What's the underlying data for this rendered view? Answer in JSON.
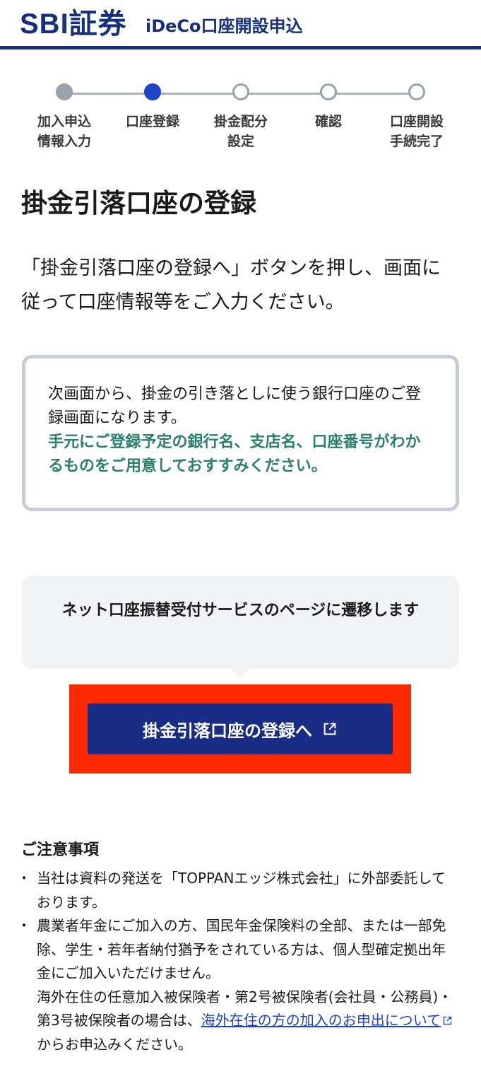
{
  "header": {
    "logo": "SBI証券",
    "title": "iDeCo口座開設申込"
  },
  "stepper": {
    "steps": [
      {
        "label": "加入申込\n情報入力",
        "state": "done"
      },
      {
        "label": "口座登録",
        "state": "current"
      },
      {
        "label": "掛金配分\n設定",
        "state": "todo"
      },
      {
        "label": "確認",
        "state": "todo"
      },
      {
        "label": "口座開設\n手続完了",
        "state": "todo"
      }
    ]
  },
  "page_title": "掛金引落口座の登録",
  "intro": "「掛金引落口座の登録へ」ボタンを押し、画面に従って口座情報等をご入力ください。",
  "note": {
    "text": "次画面から、掛金の引き落としに使う銀行口座のご登録画面になります。",
    "highlight": "手元にご登録予定の銀行名、支店名、口座番号がわかるものをご用意しておすすみください。"
  },
  "info_bubble": "ネット口座振替受付サービスのページに遷移します",
  "cta": {
    "label": "掛金引落口座の登録へ"
  },
  "notes": {
    "title": "ご注意事項",
    "item1": "当社は資料の発送を「TOPPANエッジ株式会社」に外部委託しております。",
    "item2_text": "農業者年金にご加入の方、国民年金保険料の全部、または一部免除、学生・若年者納付猶予をされている方は、個人型確定拠出年金にご加入いただけません。",
    "item2_text2": "海外在住の任意加入被保険者・第2号被保険者(会社員・公務員)・第3号被保険者の場合は、",
    "item2_link": "海外在住の方の加入のお申出について",
    "item2_suffix": "からお申込みください。"
  },
  "colors": {
    "brand": "#16307e",
    "current_step": "#1f45c8",
    "highlight_text": "#2b7f6e",
    "cta_background": "#1a2d86",
    "highlight_frame": "#ff2a00"
  },
  "icons": {
    "cta_icon": "external-link-icon",
    "link_icon": "external-link-icon"
  }
}
